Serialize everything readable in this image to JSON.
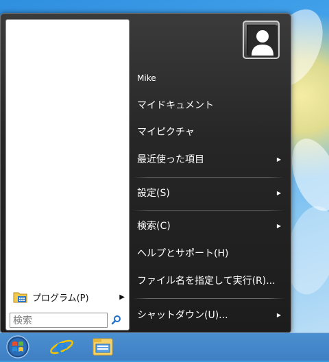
{
  "start_menu": {
    "programs_label": "プログラム(P)",
    "search_placeholder": "検索",
    "user_name": "Mike",
    "items": [
      {
        "label": "マイドキュメント"
      },
      {
        "label": "マイピクチャ"
      },
      {
        "label": "最近使った項目"
      },
      {
        "label": "設定(S)"
      },
      {
        "label": "検索(C)"
      },
      {
        "label": "ヘルプとサポート(H)"
      },
      {
        "label": "ファイル名を指定して実行(R)..."
      },
      {
        "label": "シャットダウン(U)..."
      }
    ]
  },
  "taskbar": {
    "buttons": [
      {
        "icon": "start-orb-icon"
      },
      {
        "icon": "internet-explorer-icon"
      },
      {
        "icon": "file-explorer-icon"
      }
    ]
  },
  "colors": {
    "menu_background": "#262626",
    "taskbar": "#4383c8",
    "search_icon": "#1f6fc7"
  }
}
